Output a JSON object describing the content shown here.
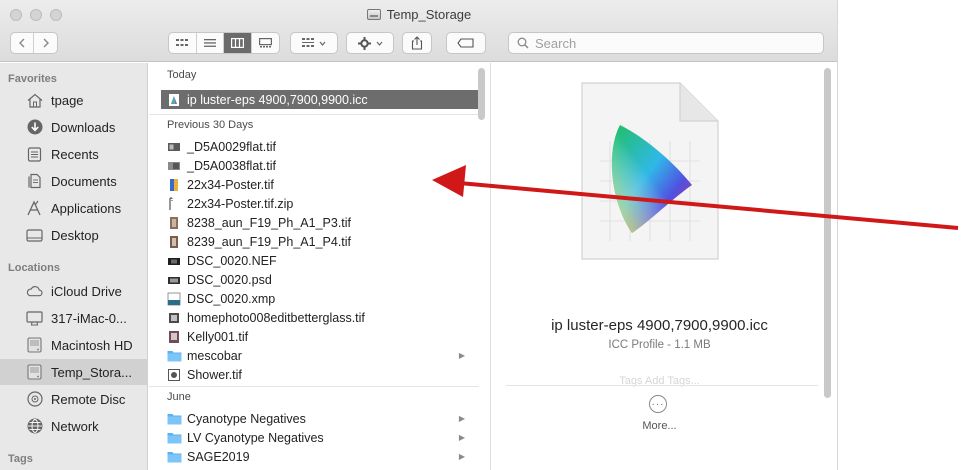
{
  "window": {
    "title": "Temp_Storage",
    "traffic_lights": [
      "close",
      "minimize",
      "zoom"
    ]
  },
  "toolbar": {
    "nav": [
      "back",
      "forward"
    ],
    "view_modes": [
      "icon",
      "list",
      "column",
      "gallery"
    ],
    "active_view": "column",
    "search_placeholder": "Search"
  },
  "sidebar": {
    "favorites_heading": "Favorites",
    "favorites": [
      {
        "label": "tpage",
        "icon": "home-icon"
      },
      {
        "label": "Downloads",
        "icon": "downloads-icon"
      },
      {
        "label": "Recents",
        "icon": "recents-icon"
      },
      {
        "label": "Documents",
        "icon": "documents-icon"
      },
      {
        "label": "Applications",
        "icon": "applications-icon"
      },
      {
        "label": "Desktop",
        "icon": "desktop-icon"
      }
    ],
    "locations_heading": "Locations",
    "locations": [
      {
        "label": "iCloud Drive",
        "icon": "cloud-icon"
      },
      {
        "label": "317-iMac-0...",
        "icon": "imac-icon"
      },
      {
        "label": "Macintosh HD",
        "icon": "hard-disk-icon"
      },
      {
        "label": "Temp_Stora...",
        "icon": "external-disk-icon",
        "selected": true
      },
      {
        "label": "Remote Disc",
        "icon": "disc-icon"
      },
      {
        "label": "Network",
        "icon": "network-icon"
      }
    ],
    "tags_heading": "Tags"
  },
  "files": {
    "today_heading": "Today",
    "today": [
      {
        "name": "ip luster-eps 4900,7900,9900.icc",
        "icon": "icc-file-icon",
        "selected": true
      }
    ],
    "previous_heading": "Previous 30 Days",
    "previous": [
      {
        "name": "_D5A0029flat.tif",
        "icon": "image-file-icon"
      },
      {
        "name": "_D5A0038flat.tif",
        "icon": "image-file-icon"
      },
      {
        "name": "22x34-Poster.tif",
        "icon": "poster-file-icon"
      },
      {
        "name": "22x34-Poster.tif.zip",
        "icon": "zip-file-icon"
      },
      {
        "name": "8238_aun_F19_Ph_A1_P3.tif",
        "icon": "image-file-icon"
      },
      {
        "name": "8239_aun_F19_Ph_A1_P4.tif",
        "icon": "image-file-icon"
      },
      {
        "name": "DSC_0020.NEF",
        "icon": "raw-file-icon"
      },
      {
        "name": "DSC_0020.psd",
        "icon": "psd-file-icon"
      },
      {
        "name": "DSC_0020.xmp",
        "icon": "xmp-file-icon"
      },
      {
        "name": "homephoto008editbetterglass.tif",
        "icon": "image-file-icon"
      },
      {
        "name": "Kelly001.tif",
        "icon": "image-file-icon"
      },
      {
        "name": "mescobar",
        "icon": "folder-icon",
        "folder": true
      },
      {
        "name": "Shower.tif",
        "icon": "image-file-icon"
      }
    ],
    "june_heading": "June",
    "june": [
      {
        "name": "Cyanotype Negatives",
        "icon": "folder-icon",
        "folder": true
      },
      {
        "name": "LV Cyanotype Negatives",
        "icon": "folder-icon",
        "folder": true
      },
      {
        "name": "SAGE2019",
        "icon": "folder-icon",
        "folder": true
      }
    ]
  },
  "preview": {
    "name": "ip luster-eps 4900,7900,9900.icc",
    "kind": "ICC Profile - 1.1 MB",
    "faded_text": "Tags  Add Tags...",
    "more_label": "More..."
  },
  "annotation": {
    "arrow_color": "#d01818"
  }
}
